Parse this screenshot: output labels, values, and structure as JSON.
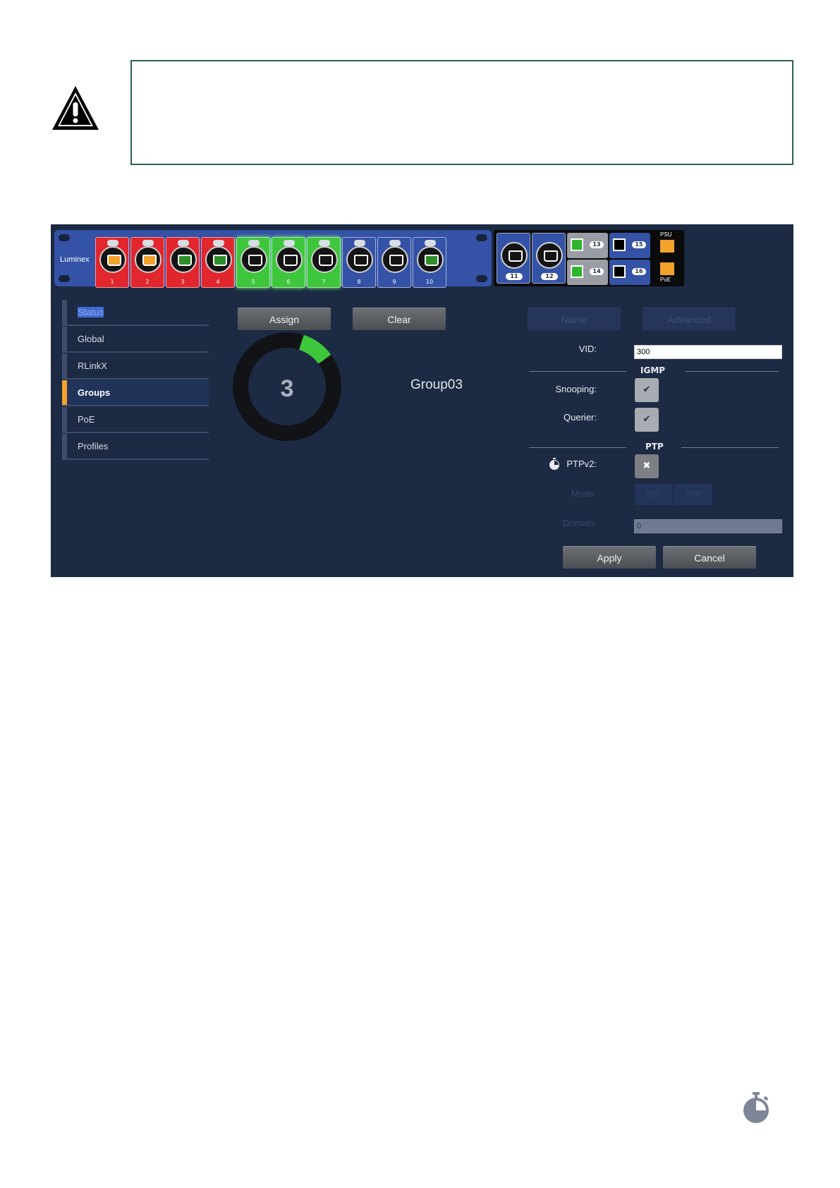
{
  "rack": {
    "brand": "Luminex",
    "ports": [
      "1",
      "2",
      "3",
      "4",
      "5",
      "6",
      "7",
      "8",
      "9",
      "10"
    ],
    "sfp_ports": [
      "11",
      "12"
    ],
    "sfp_cages": [
      "13",
      "14",
      "15",
      "16"
    ],
    "psu_label": "PSU",
    "poe_label": "PoE"
  },
  "sidebar": {
    "items": [
      {
        "label": "Status"
      },
      {
        "label": "Global"
      },
      {
        "label": "RLinkX"
      },
      {
        "label": "Groups"
      },
      {
        "label": "PoE"
      },
      {
        "label": "Profiles"
      }
    ]
  },
  "actions": {
    "assign": "Assign",
    "clear": "Clear",
    "name": "Name",
    "advanced": "Advanced",
    "apply": "Apply",
    "cancel": "Cancel"
  },
  "group": {
    "number": "3",
    "name": "Group03",
    "ring_fraction": 0.1
  },
  "form": {
    "vid_label": "VID:",
    "vid_value": "300",
    "igmp_title": "IGMP",
    "snooping_label": "Snooping:",
    "snooping_checked": "✔",
    "querier_label": "Querier:",
    "querier_checked": "✔",
    "ptp_title": "PTP",
    "ptpv2_label": "PTPv2:",
    "ptpv2_value": "✖",
    "mode_label": "Mode:",
    "mode_options": [
      "E2E",
      "P2P"
    ],
    "domain_label": "Domain:",
    "domain_value": "0"
  },
  "colors": {
    "panel_bg": "#1c2a44",
    "active_accent": "#f3a22c",
    "group_green": "#3ec63c",
    "port_red": "#e2262d",
    "rack_blue": "#3452a6"
  }
}
